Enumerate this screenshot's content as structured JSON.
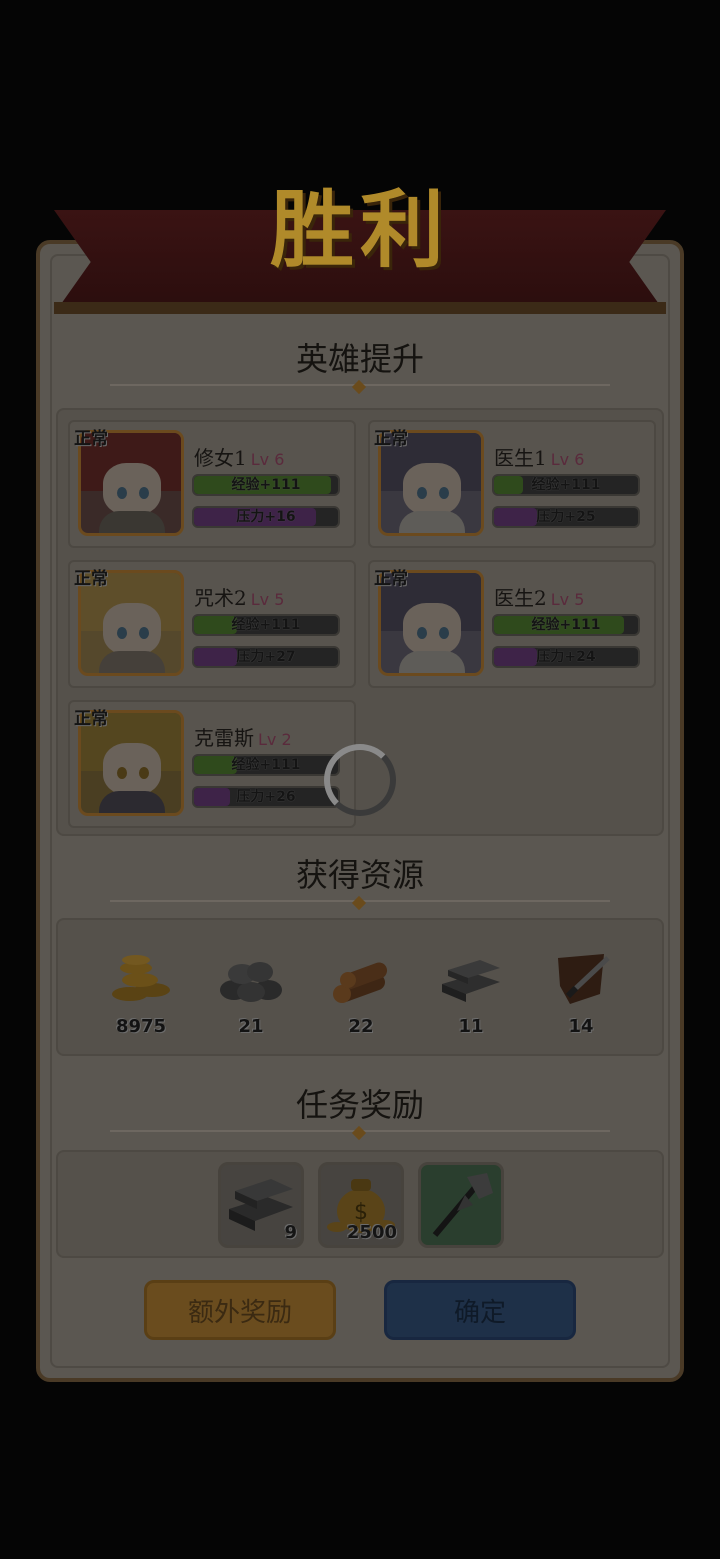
{
  "title": "胜利",
  "sections": {
    "heroes_title": "英雄提升",
    "resources_title": "获得资源",
    "rewards_title": "任务奖励"
  },
  "heroes": [
    {
      "name": "修女1",
      "level": "Lv 6",
      "status": "正常",
      "exp_label": "经验+111",
      "exp_fill": 0.95,
      "stress_label": "压力+16",
      "stress_fill": 0.85
    },
    {
      "name": "医生1",
      "level": "Lv 6",
      "status": "正常",
      "exp_label": "经验+111",
      "exp_fill": 0.2,
      "stress_label": "压力+25",
      "stress_fill": 0.3
    },
    {
      "name": "咒术2",
      "level": "Lv 5",
      "status": "正常",
      "exp_label": "经验+111",
      "exp_fill": 0.3,
      "stress_label": "压力+27",
      "stress_fill": 0.3
    },
    {
      "name": "医生2",
      "level": "Lv 5",
      "status": "正常",
      "exp_label": "经验+111",
      "exp_fill": 0.9,
      "stress_label": "压力+24",
      "stress_fill": 0.3
    },
    {
      "name": "克雷斯",
      "level": "Lv 2",
      "status": "正常",
      "exp_label": "经验+111",
      "exp_fill": 0.3,
      "stress_label": "压力+26",
      "stress_fill": 0.25
    }
  ],
  "resources": [
    {
      "icon": "gold-coins-icon",
      "value": "8975"
    },
    {
      "icon": "stone-pile-icon",
      "value": "21"
    },
    {
      "icon": "wood-logs-icon",
      "value": "22"
    },
    {
      "icon": "iron-ingots-icon",
      "value": "11"
    },
    {
      "icon": "leather-knife-icon",
      "value": "14"
    }
  ],
  "rewards": [
    {
      "icon": "iron-ingots-icon",
      "count": "9"
    },
    {
      "icon": "money-bag-icon",
      "count": "2500"
    },
    {
      "icon": "battle-axe-icon",
      "count": ""
    }
  ],
  "buttons": {
    "extra_reward": "额外奖励",
    "confirm": "确定"
  },
  "colors": {
    "overlay_dim": "#050505",
    "exp_bar": "#2f4a1c",
    "stress_bar": "#3e2348",
    "extra_button": "#6a4c1e",
    "confirm_button": "#1e3048"
  }
}
